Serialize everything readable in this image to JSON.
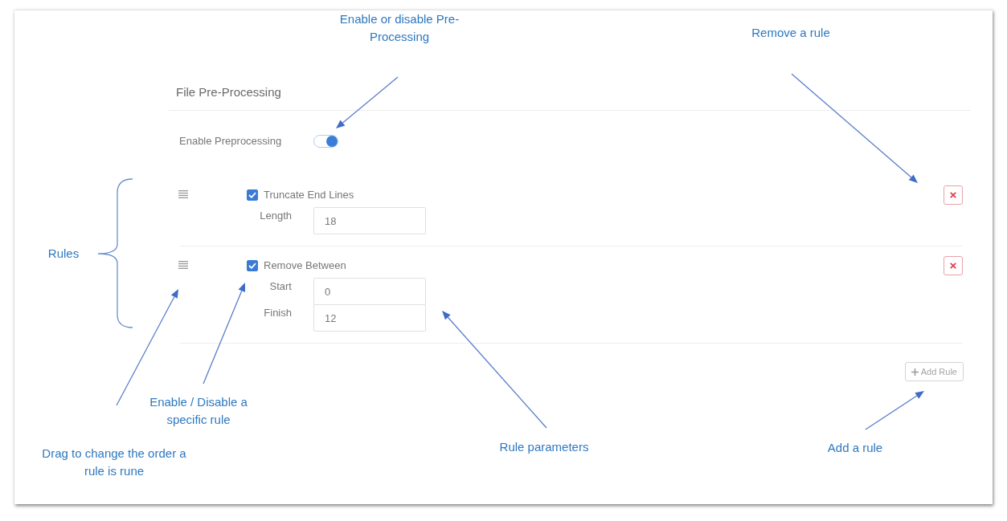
{
  "panel": {
    "title": "File Pre-Processing",
    "enable": {
      "label": "Enable Preprocessing",
      "on": true
    },
    "rules": [
      {
        "label": "Truncate End Lines",
        "checked": true,
        "params": [
          {
            "label": "Length",
            "value": "18"
          }
        ]
      },
      {
        "label": "Remove Between",
        "checked": true,
        "params": [
          {
            "label": "Start",
            "value": "0"
          },
          {
            "label": "Finish",
            "value": "12"
          }
        ]
      }
    ],
    "add_button": {
      "label": "Add Rule"
    }
  },
  "annotations": [
    {
      "lines": [
        "Enable or disable Pre-",
        "Processing"
      ]
    },
    {
      "lines": [
        "Remove a rule"
      ]
    },
    {
      "lines": [
        "Rules"
      ]
    },
    {
      "lines": [
        "Enable / Disable a",
        "specific rule"
      ]
    },
    {
      "lines": [
        "Drag to change the order a",
        "rule is rune"
      ]
    },
    {
      "lines": [
        "Rule parameters"
      ]
    },
    {
      "lines": [
        "Add a rule"
      ]
    }
  ]
}
